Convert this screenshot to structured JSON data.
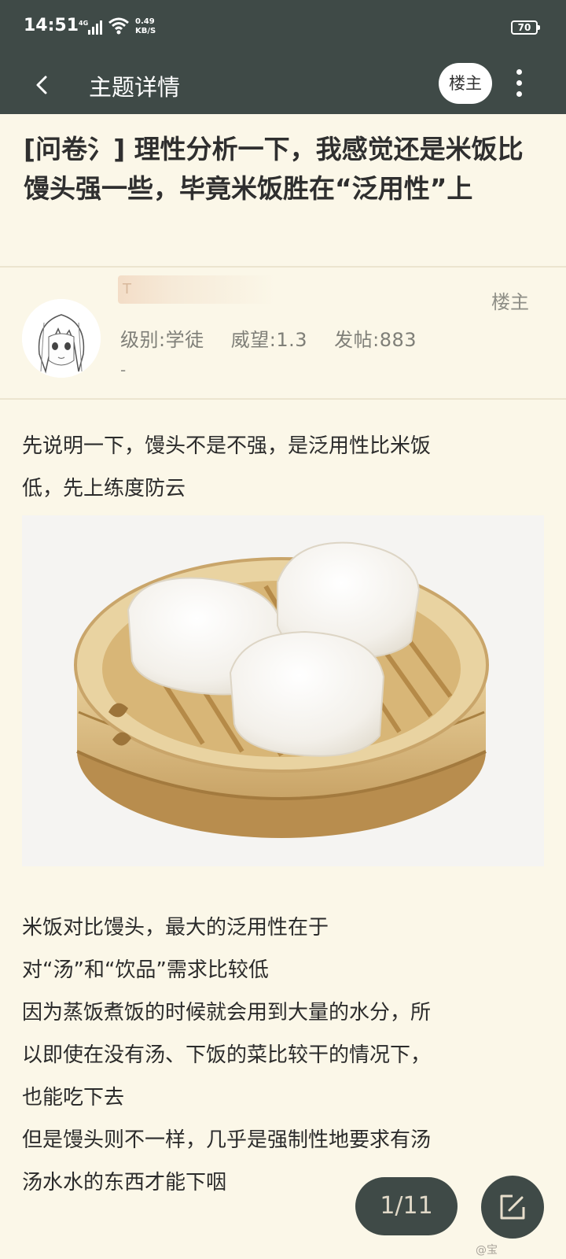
{
  "status_bar": {
    "time": "14:51",
    "network": "4G",
    "speed_value": "0.49",
    "speed_unit": "KB/S",
    "battery": "70"
  },
  "nav": {
    "title": "主题详情",
    "louzhu_button": "楼主",
    "back_icon": "chevron-left-icon",
    "more_icon": "more-vertical-icon"
  },
  "topic": {
    "title": "[问卷氵] 理性分析一下，我感觉还是米饭比馒头强一些，毕竟米饭胜在“泛用性”上"
  },
  "author": {
    "name": "T",
    "tag": "楼主",
    "level": "级别:学徒",
    "prestige": "威望:1.3",
    "posts": "发帖:883",
    "extra": "-"
  },
  "post": {
    "intro_lines": [
      "先说明一下，馒头不是不强，是泛用性比米饭",
      "低，先上练度防云"
    ],
    "body_lines": [
      "米饭对比馒头，最大的泛用性在于",
      "对“汤”和“饮品”需求比较低",
      "因为蒸饭煮饭的时候就会用到大量的水分，所",
      "以即使在没有汤、下饭的菜比较干的情况下，",
      "也能吃下去",
      "但是馒头则不一样，几乎是强制性地要求有汤",
      "汤水水的东西才能下咽"
    ]
  },
  "pagination": {
    "label": "1/11"
  },
  "fab": {
    "icon": "edit-icon"
  },
  "watermark": "@宝"
}
